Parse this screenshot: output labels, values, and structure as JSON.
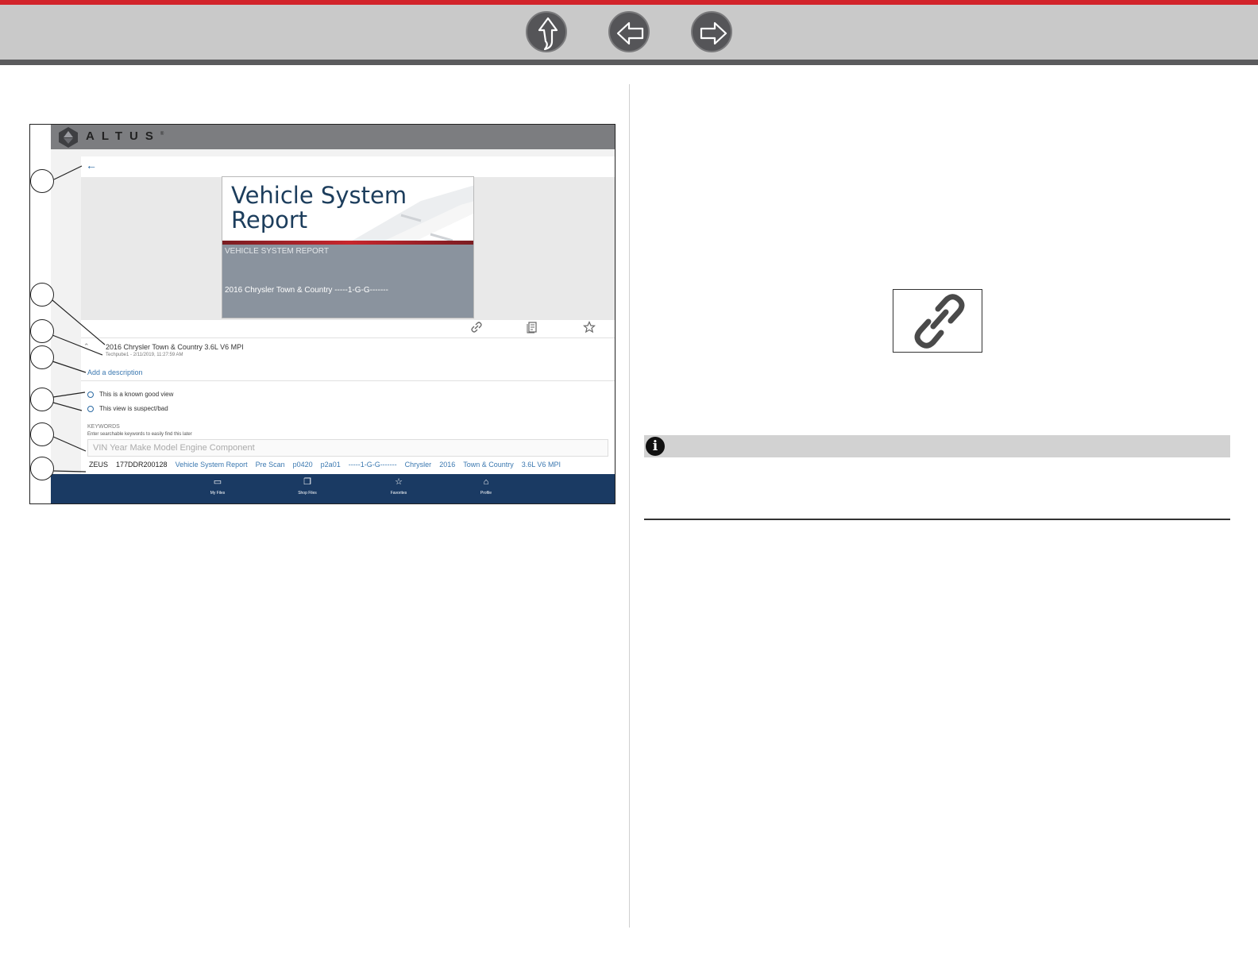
{
  "nav": {
    "up_icon": "up-arrow-icon",
    "back_icon": "left-arrow-icon",
    "forward_icon": "right-arrow-icon"
  },
  "figure": {
    "app": {
      "logo_text": "ALTUS",
      "trademark": "®",
      "back_icon": "back-arrow-icon",
      "kebab": "⋮",
      "report": {
        "title_line1": "Vehicle System",
        "title_line2": "Report",
        "subtitle": "VEHICLE SYSTEM REPORT",
        "vehicle": "2016  Chrysler  Town & Country  -----1-G-G-------"
      },
      "actions": [
        "link-icon",
        "document-icon",
        "star-icon"
      ],
      "file_name": "2016 Chrysler Town & Country 3.6L V6 MPI",
      "file_meta": "Techpube1 - 2/11/2019, 11:27:59 AM",
      "add_description": "Add a description",
      "radio_good": "This is a known good view",
      "radio_bad": "This view is suspect/bad",
      "keywords_title": "KEYWORDS",
      "keywords_hint": "Enter searchable keywords to easily find this later",
      "keywords_placeholder": "VIN Year Make Model Engine Component",
      "tags": [
        {
          "text": "ZEUS",
          "plain": true
        },
        {
          "text": "177DDR200128",
          "plain": true
        },
        {
          "text": "Vehicle System Report",
          "plain": false
        },
        {
          "text": "Pre Scan",
          "plain": false
        },
        {
          "text": "p0420",
          "plain": false
        },
        {
          "text": "p2a01",
          "plain": false
        },
        {
          "text": "-----1-G-G-------",
          "plain": false
        },
        {
          "text": "Chrysler",
          "plain": false
        },
        {
          "text": "2016",
          "plain": false
        },
        {
          "text": "Town & Country",
          "plain": false
        },
        {
          "text": "3.6L V6 MPI",
          "plain": false
        }
      ],
      "footer": [
        {
          "label": "My Files",
          "icon": "folder-icon"
        },
        {
          "label": "Shop Files",
          "icon": "files-icon"
        },
        {
          "label": "Favorites",
          "icon": "star-icon"
        },
        {
          "label": "Profile",
          "icon": "profile-icon"
        }
      ]
    },
    "callout_count": 7
  },
  "right": {
    "link_icon": "chain-link-icon",
    "note_icon": "i"
  },
  "colors": {
    "red_accent": "#d2232a",
    "nav_gray": "#c9c9c9",
    "app_footer": "#1a3a63",
    "link_blue": "#3b78b0"
  }
}
